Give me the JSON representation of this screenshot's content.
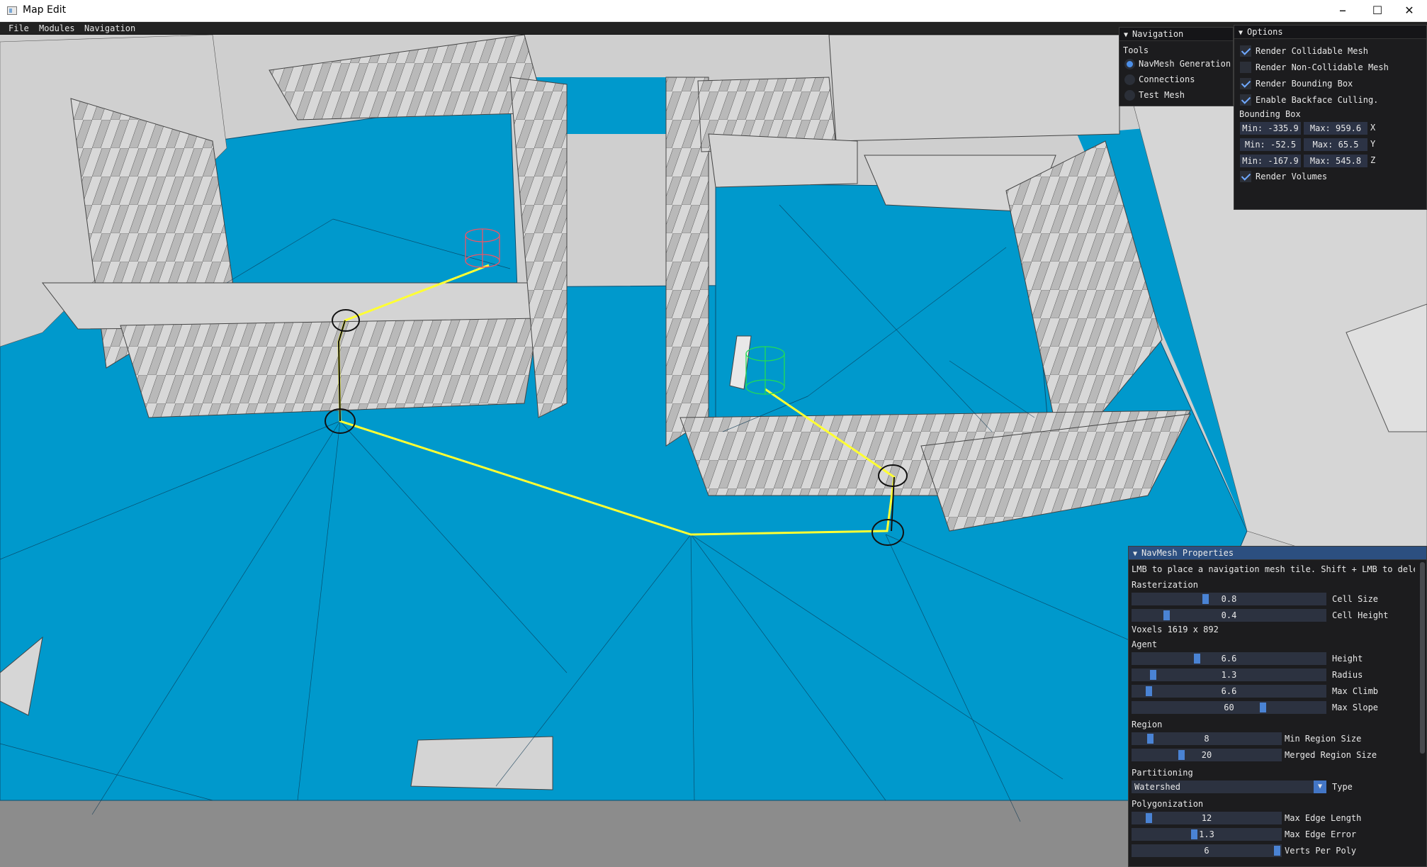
{
  "window": {
    "title": "Map Edit",
    "minimize_glyph": "–",
    "maximize_glyph": "☐",
    "close_glyph": "✕"
  },
  "menu": {
    "items": [
      "File",
      "Modules",
      "Navigation"
    ]
  },
  "navigation_panel": {
    "title": "Navigation",
    "tools_label": "Tools",
    "tools": [
      {
        "label": "NavMesh Generation",
        "selected": true
      },
      {
        "label": "Connections",
        "selected": false
      },
      {
        "label": "Test Mesh",
        "selected": false
      }
    ]
  },
  "options_panel": {
    "title": "Options",
    "checkboxes": [
      {
        "label": "Render Collidable Mesh",
        "checked": true
      },
      {
        "label": "Render Non-Collidable Mesh",
        "checked": false
      },
      {
        "label": "Render Bounding Box",
        "checked": true
      },
      {
        "label": "Enable Backface Culling.",
        "checked": true
      }
    ],
    "bounding_box_label": "Bounding Box",
    "bounding_box": [
      {
        "min": "Min: -335.9",
        "max": "Max: 959.6",
        "axis": "X"
      },
      {
        "min": "Min: -52.5",
        "max": "Max: 65.5",
        "axis": "Y"
      },
      {
        "min": "Min: -167.9",
        "max": "Max: 545.8",
        "axis": "Z"
      }
    ],
    "render_volumes": {
      "label": "Render Volumes",
      "checked": true
    }
  },
  "navmesh_panel": {
    "title": "NavMesh Properties",
    "hint": "LMB to place a navigation mesh tile. Shift + LMB to delet",
    "rasterization_label": "Rasterization",
    "rasterization": [
      {
        "value": "0.8",
        "label": "Cell Size",
        "fraction": 0.37
      },
      {
        "value": "0.4",
        "label": "Cell Height",
        "fraction": 0.17
      }
    ],
    "voxels": "Voxels  1619 x 892",
    "agent_label": "Agent",
    "agent": [
      {
        "value": "6.6",
        "label": "Height",
        "fraction": 0.33
      },
      {
        "value": "1.3",
        "label": "Radius",
        "fraction": 0.1
      },
      {
        "value": "6.6",
        "label": "Max Climb",
        "fraction": 0.08
      },
      {
        "value": "60",
        "label": "Max Slope",
        "fraction": 0.67
      }
    ],
    "region_label": "Region",
    "region": [
      {
        "value": "8",
        "label": "Min Region Size",
        "fraction": 0.12
      },
      {
        "value": "20",
        "label": "Merged Region Size",
        "fraction": 0.33
      }
    ],
    "partitioning_label": "Partitioning",
    "partitioning": {
      "value": "Watershed",
      "label": "Type"
    },
    "polygonization_label": "Polygonization",
    "polygonization": [
      {
        "value": "12",
        "label": "Max Edge Length",
        "fraction": 0.09
      },
      {
        "value": "1.3",
        "label": "Max Edge Error",
        "fraction": 0.41
      },
      {
        "value": "6",
        "label": "Verts Per Poly",
        "fraction": 0.98
      }
    ]
  },
  "colors": {
    "navmesh": "#0099cc",
    "geometry": "#d0d0d0",
    "ground": "#8a8a8a",
    "path": "#ffff33",
    "start_marker": "#22dd55",
    "end_marker": "#ee5566"
  }
}
